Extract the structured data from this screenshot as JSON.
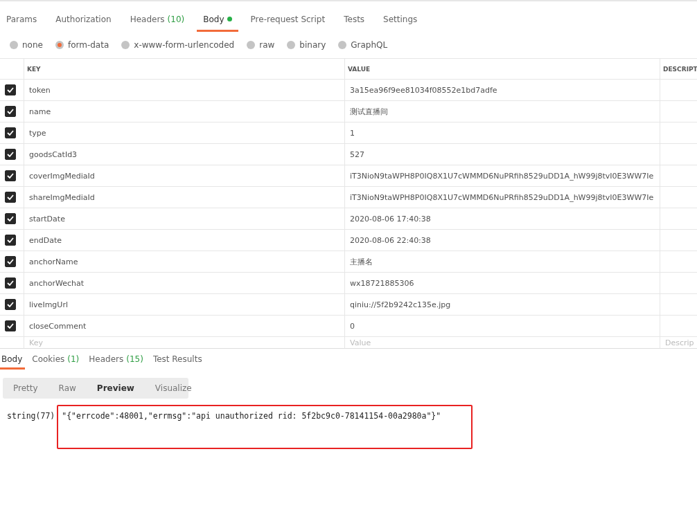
{
  "request_tabs": [
    {
      "label": "Params",
      "selected": false
    },
    {
      "label": "Authorization",
      "selected": false
    },
    {
      "label": "Headers",
      "count": "(10)",
      "selected": false
    },
    {
      "label": "Body",
      "dot": true,
      "selected": true
    },
    {
      "label": "Pre-request Script",
      "selected": false
    },
    {
      "label": "Tests",
      "selected": false
    },
    {
      "label": "Settings",
      "selected": false
    }
  ],
  "body_types": [
    {
      "label": "none",
      "selected": false
    },
    {
      "label": "form-data",
      "selected": true
    },
    {
      "label": "x-www-form-urlencoded",
      "selected": false
    },
    {
      "label": "raw",
      "selected": false
    },
    {
      "label": "binary",
      "selected": false
    },
    {
      "label": "GraphQL",
      "selected": false
    }
  ],
  "table": {
    "columns": [
      "KEY",
      "VALUE",
      "DESCRIPT"
    ],
    "rows": [
      {
        "checked": true,
        "key": "token",
        "value": "3a15ea96f9ee81034f08552e1bd7adfe"
      },
      {
        "checked": true,
        "key": "name",
        "value": "测试直播间"
      },
      {
        "checked": true,
        "key": "type",
        "value": "1"
      },
      {
        "checked": true,
        "key": "goodsCatId3",
        "value": "527"
      },
      {
        "checked": true,
        "key": "coverImgMediaId",
        "value": "iT3NioN9taWPH8P0IQ8X1U7cWMMD6NuPRfih8529uDD1A_hW99j8tvI0E3WW7Ie"
      },
      {
        "checked": true,
        "key": "shareImgMediaId",
        "value": "iT3NioN9taWPH8P0IQ8X1U7cWMMD6NuPRfih8529uDD1A_hW99j8tvI0E3WW7Ie"
      },
      {
        "checked": true,
        "key": "startDate",
        "value": "2020-08-06 17:40:38"
      },
      {
        "checked": true,
        "key": "endDate",
        "value": "2020-08-06 22:40:38"
      },
      {
        "checked": true,
        "key": "anchorName",
        "value": "主播名"
      },
      {
        "checked": true,
        "key": "anchorWechat",
        "value": "wx18721885306"
      },
      {
        "checked": true,
        "key": "liveImgUrl",
        "value": "qiniu://5f2b9242c135e.jpg"
      },
      {
        "checked": true,
        "key": "closeComment",
        "value": "0"
      }
    ],
    "new_row": {
      "key_placeholder": "Key",
      "value_placeholder": "Value",
      "description_placeholder": "Descrip"
    }
  },
  "response_tabs": [
    {
      "label": "Body",
      "selected": true
    },
    {
      "label": "Cookies",
      "count": "(1)",
      "selected": false
    },
    {
      "label": "Headers",
      "count": "(15)",
      "selected": false
    },
    {
      "label": "Test Results",
      "selected": false
    }
  ],
  "view_modes": [
    {
      "label": "Pretty",
      "selected": false
    },
    {
      "label": "Raw",
      "selected": false
    },
    {
      "label": "Preview",
      "selected": true
    },
    {
      "label": "Visualize",
      "selected": false
    }
  ],
  "response": {
    "prefix": "string(77)",
    "body": "\"{\"errcode\":48001,\"errmsg\":\"api unauthorized rid: 5f2bc9c0-78141154-00a2980a\"}\"",
    "highlighted": true
  }
}
